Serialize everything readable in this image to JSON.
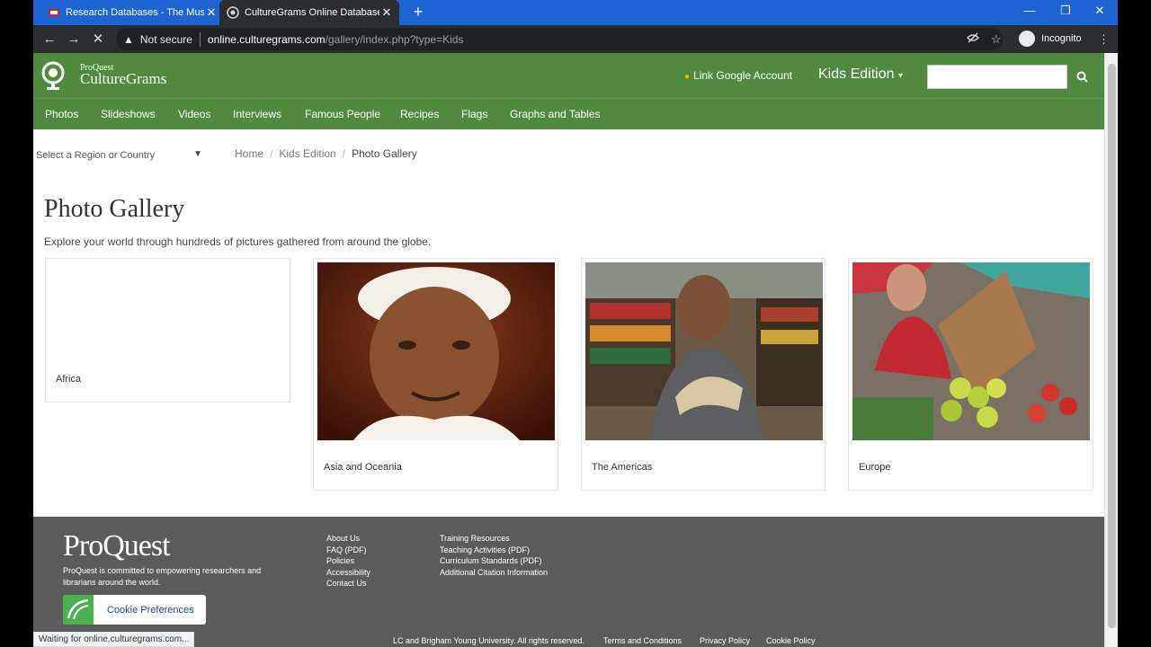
{
  "browser": {
    "tabs": [
      {
        "title": "Research Databases - The Muski",
        "active": false
      },
      {
        "title": "CultureGrams Online Database |",
        "active": true
      }
    ],
    "security_label": "Not secure",
    "url_host": "online.culturegrams.com",
    "url_path": "/gallery/index.php?type=Kids",
    "profile_label": "Incognito",
    "status_text": "Waiting for online.culturegrams.com..."
  },
  "header": {
    "logo_small": "ProQuest",
    "logo_main": "CultureGrams",
    "google_link": "Link Google Account",
    "edition": "Kids Edition",
    "search_placeholder": ""
  },
  "nav": {
    "items": [
      "Photos",
      "Slideshows",
      "Videos",
      "Interviews",
      "Famous People",
      "Recipes",
      "Flags",
      "Graphs and Tables"
    ]
  },
  "region_select": {
    "label": "Select a Region or Country"
  },
  "breadcrumb": {
    "home": "Home",
    "edition": "Kids Edition",
    "current": "Photo Gallery"
  },
  "main": {
    "title": "Photo Gallery",
    "subtitle": "Explore your world through hundreds of pictures gathered from around the globe.",
    "cards": [
      {
        "label": "Africa"
      },
      {
        "label": "Asia and Oceania"
      },
      {
        "label": "The Americas"
      },
      {
        "label": "Europe"
      }
    ]
  },
  "footer": {
    "logo": "ProQuest",
    "tagline": "ProQuest is committed to empowering researchers and librarians around the world.",
    "col1": [
      "About Us",
      "FAQ (PDF)",
      "Policies",
      "Accessibility",
      "Contact Us"
    ],
    "col2": [
      "Training Resources",
      "Teaching Activities (PDF)",
      "Curriculum Standards (PDF)",
      "Additional Citation Information"
    ],
    "cookie_button": "Cookie Preferences",
    "copyright": "LC and Brigham Young University. All rights reserved.",
    "links": [
      "Terms and Conditions",
      "Privacy Policy",
      "Cookie Policy"
    ]
  },
  "colors": {
    "header_green": "#4f8a3f",
    "tab_blue": "#1e63d2",
    "footer_gray": "#5b5b5b"
  }
}
